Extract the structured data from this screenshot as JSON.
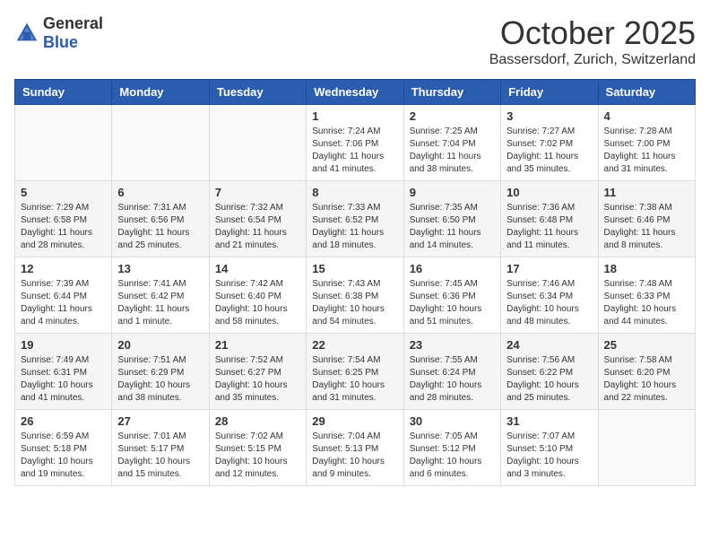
{
  "header": {
    "logo_general": "General",
    "logo_blue": "Blue",
    "month": "October 2025",
    "location": "Bassersdorf, Zurich, Switzerland"
  },
  "weekdays": [
    "Sunday",
    "Monday",
    "Tuesday",
    "Wednesday",
    "Thursday",
    "Friday",
    "Saturday"
  ],
  "weeks": [
    [
      {
        "day": "",
        "sunrise": "",
        "sunset": "",
        "daylight": ""
      },
      {
        "day": "",
        "sunrise": "",
        "sunset": "",
        "daylight": ""
      },
      {
        "day": "",
        "sunrise": "",
        "sunset": "",
        "daylight": ""
      },
      {
        "day": "1",
        "sunrise": "Sunrise: 7:24 AM",
        "sunset": "Sunset: 7:06 PM",
        "daylight": "Daylight: 11 hours and 41 minutes."
      },
      {
        "day": "2",
        "sunrise": "Sunrise: 7:25 AM",
        "sunset": "Sunset: 7:04 PM",
        "daylight": "Daylight: 11 hours and 38 minutes."
      },
      {
        "day": "3",
        "sunrise": "Sunrise: 7:27 AM",
        "sunset": "Sunset: 7:02 PM",
        "daylight": "Daylight: 11 hours and 35 minutes."
      },
      {
        "day": "4",
        "sunrise": "Sunrise: 7:28 AM",
        "sunset": "Sunset: 7:00 PM",
        "daylight": "Daylight: 11 hours and 31 minutes."
      }
    ],
    [
      {
        "day": "5",
        "sunrise": "Sunrise: 7:29 AM",
        "sunset": "Sunset: 6:58 PM",
        "daylight": "Daylight: 11 hours and 28 minutes."
      },
      {
        "day": "6",
        "sunrise": "Sunrise: 7:31 AM",
        "sunset": "Sunset: 6:56 PM",
        "daylight": "Daylight: 11 hours and 25 minutes."
      },
      {
        "day": "7",
        "sunrise": "Sunrise: 7:32 AM",
        "sunset": "Sunset: 6:54 PM",
        "daylight": "Daylight: 11 hours and 21 minutes."
      },
      {
        "day": "8",
        "sunrise": "Sunrise: 7:33 AM",
        "sunset": "Sunset: 6:52 PM",
        "daylight": "Daylight: 11 hours and 18 minutes."
      },
      {
        "day": "9",
        "sunrise": "Sunrise: 7:35 AM",
        "sunset": "Sunset: 6:50 PM",
        "daylight": "Daylight: 11 hours and 14 minutes."
      },
      {
        "day": "10",
        "sunrise": "Sunrise: 7:36 AM",
        "sunset": "Sunset: 6:48 PM",
        "daylight": "Daylight: 11 hours and 11 minutes."
      },
      {
        "day": "11",
        "sunrise": "Sunrise: 7:38 AM",
        "sunset": "Sunset: 6:46 PM",
        "daylight": "Daylight: 11 hours and 8 minutes."
      }
    ],
    [
      {
        "day": "12",
        "sunrise": "Sunrise: 7:39 AM",
        "sunset": "Sunset: 6:44 PM",
        "daylight": "Daylight: 11 hours and 4 minutes."
      },
      {
        "day": "13",
        "sunrise": "Sunrise: 7:41 AM",
        "sunset": "Sunset: 6:42 PM",
        "daylight": "Daylight: 11 hours and 1 minute."
      },
      {
        "day": "14",
        "sunrise": "Sunrise: 7:42 AM",
        "sunset": "Sunset: 6:40 PM",
        "daylight": "Daylight: 10 hours and 58 minutes."
      },
      {
        "day": "15",
        "sunrise": "Sunrise: 7:43 AM",
        "sunset": "Sunset: 6:38 PM",
        "daylight": "Daylight: 10 hours and 54 minutes."
      },
      {
        "day": "16",
        "sunrise": "Sunrise: 7:45 AM",
        "sunset": "Sunset: 6:36 PM",
        "daylight": "Daylight: 10 hours and 51 minutes."
      },
      {
        "day": "17",
        "sunrise": "Sunrise: 7:46 AM",
        "sunset": "Sunset: 6:34 PM",
        "daylight": "Daylight: 10 hours and 48 minutes."
      },
      {
        "day": "18",
        "sunrise": "Sunrise: 7:48 AM",
        "sunset": "Sunset: 6:33 PM",
        "daylight": "Daylight: 10 hours and 44 minutes."
      }
    ],
    [
      {
        "day": "19",
        "sunrise": "Sunrise: 7:49 AM",
        "sunset": "Sunset: 6:31 PM",
        "daylight": "Daylight: 10 hours and 41 minutes."
      },
      {
        "day": "20",
        "sunrise": "Sunrise: 7:51 AM",
        "sunset": "Sunset: 6:29 PM",
        "daylight": "Daylight: 10 hours and 38 minutes."
      },
      {
        "day": "21",
        "sunrise": "Sunrise: 7:52 AM",
        "sunset": "Sunset: 6:27 PM",
        "daylight": "Daylight: 10 hours and 35 minutes."
      },
      {
        "day": "22",
        "sunrise": "Sunrise: 7:54 AM",
        "sunset": "Sunset: 6:25 PM",
        "daylight": "Daylight: 10 hours and 31 minutes."
      },
      {
        "day": "23",
        "sunrise": "Sunrise: 7:55 AM",
        "sunset": "Sunset: 6:24 PM",
        "daylight": "Daylight: 10 hours and 28 minutes."
      },
      {
        "day": "24",
        "sunrise": "Sunrise: 7:56 AM",
        "sunset": "Sunset: 6:22 PM",
        "daylight": "Daylight: 10 hours and 25 minutes."
      },
      {
        "day": "25",
        "sunrise": "Sunrise: 7:58 AM",
        "sunset": "Sunset: 6:20 PM",
        "daylight": "Daylight: 10 hours and 22 minutes."
      }
    ],
    [
      {
        "day": "26",
        "sunrise": "Sunrise: 6:59 AM",
        "sunset": "Sunset: 5:18 PM",
        "daylight": "Daylight: 10 hours and 19 minutes."
      },
      {
        "day": "27",
        "sunrise": "Sunrise: 7:01 AM",
        "sunset": "Sunset: 5:17 PM",
        "daylight": "Daylight: 10 hours and 15 minutes."
      },
      {
        "day": "28",
        "sunrise": "Sunrise: 7:02 AM",
        "sunset": "Sunset: 5:15 PM",
        "daylight": "Daylight: 10 hours and 12 minutes."
      },
      {
        "day": "29",
        "sunrise": "Sunrise: 7:04 AM",
        "sunset": "Sunset: 5:13 PM",
        "daylight": "Daylight: 10 hours and 9 minutes."
      },
      {
        "day": "30",
        "sunrise": "Sunrise: 7:05 AM",
        "sunset": "Sunset: 5:12 PM",
        "daylight": "Daylight: 10 hours and 6 minutes."
      },
      {
        "day": "31",
        "sunrise": "Sunrise: 7:07 AM",
        "sunset": "Sunset: 5:10 PM",
        "daylight": "Daylight: 10 hours and 3 minutes."
      },
      {
        "day": "",
        "sunrise": "",
        "sunset": "",
        "daylight": ""
      }
    ]
  ]
}
